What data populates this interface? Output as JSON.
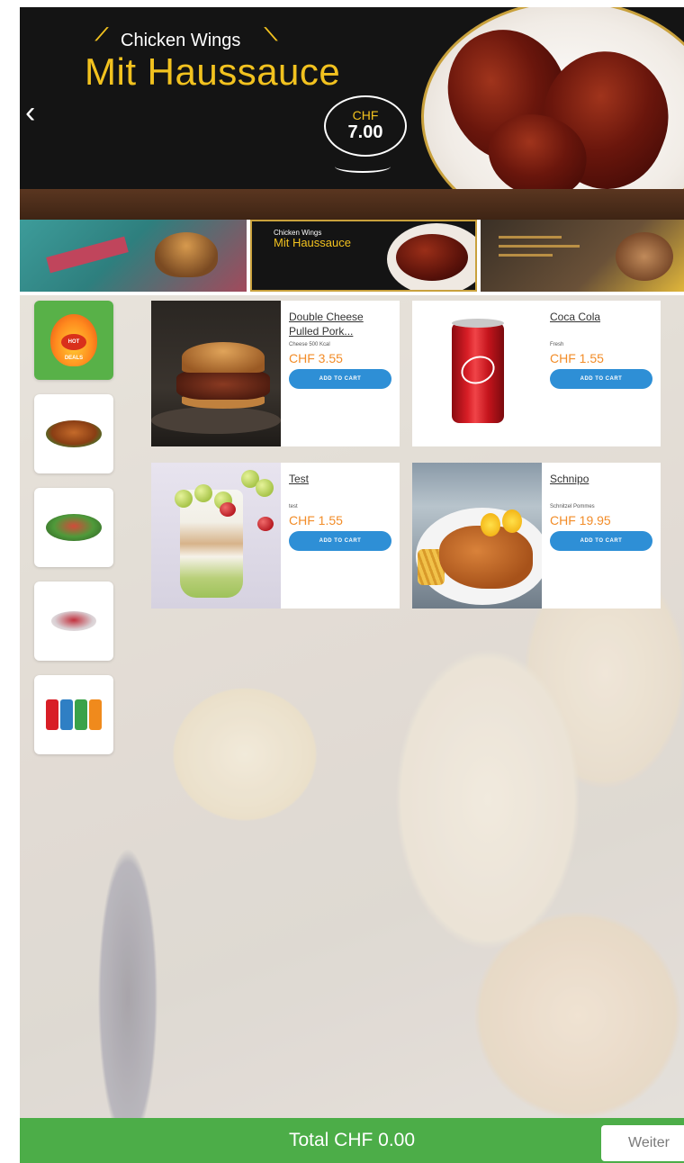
{
  "hero": {
    "subtitle": "Chicken Wings",
    "title": "Mit Haussauce",
    "price_currency": "CHF",
    "price_value": "7.00",
    "prev_icon": "chevron-left-icon"
  },
  "thumbnails": [
    {
      "name": "burger-promo-thumbnail"
    },
    {
      "name": "chicken-wings-promo-thumbnail",
      "subtitle": "Chicken Wings",
      "title": "Mit Haussauce"
    },
    {
      "name": "promo-thumbnail-3"
    }
  ],
  "categories": [
    {
      "id": "hot-deals",
      "icon": "hot-deals-flame-icon",
      "badge": "HOT DEALS",
      "active": true
    },
    {
      "id": "chicken",
      "icon": "chicken-dish-icon",
      "active": false
    },
    {
      "id": "salad",
      "icon": "salad-dish-icon",
      "active": false
    },
    {
      "id": "dessert",
      "icon": "dessert-dish-icon",
      "active": false
    },
    {
      "id": "drinks",
      "icon": "drink-cans-icon",
      "active": false
    }
  ],
  "products": [
    {
      "name": "Double Cheese Pulled Pork...",
      "meta": "Cheese 500 Kcal",
      "price": "CHF 3.55",
      "button": "ADD TO CART"
    },
    {
      "name": "Coca Cola",
      "meta": "Fresh",
      "price": "CHF 1.55",
      "button": "ADD TO CART"
    },
    {
      "name": "Test",
      "meta": "test",
      "price": "CHF 1.55",
      "button": "ADD TO CART"
    },
    {
      "name": "Schnipo",
      "meta": "Schnitzel Pommes",
      "price": "CHF 19.95",
      "button": "ADD TO CART"
    }
  ],
  "footer": {
    "total": "Total CHF 0.00",
    "next_button": "Weiter"
  },
  "colors": {
    "accent_green": "#4cad48",
    "button_blue": "#2e8fd6",
    "price_orange": "#f28c28",
    "hero_gold": "#f2c21f"
  }
}
